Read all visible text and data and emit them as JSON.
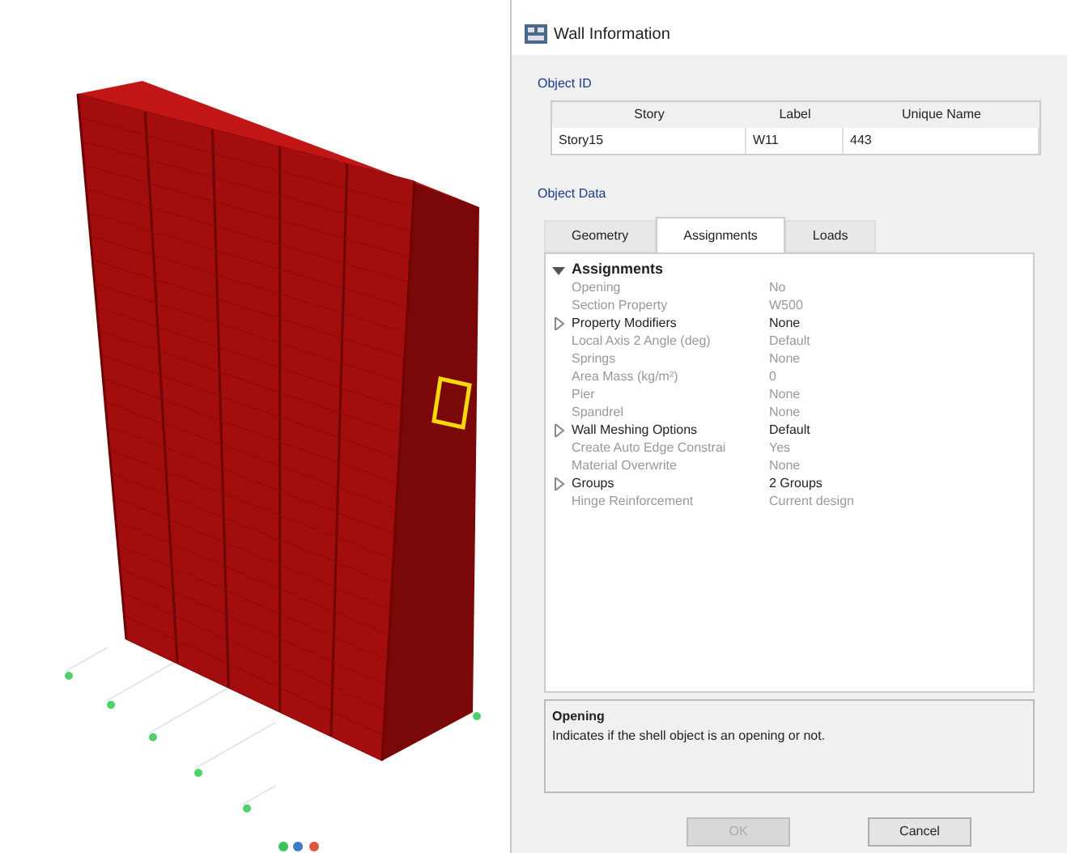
{
  "window": {
    "title": "Wall Information"
  },
  "object_id": {
    "title": "Object ID",
    "columns": [
      "Story",
      "Label",
      "Unique Name"
    ],
    "row": [
      "Story15",
      "W11",
      "443"
    ]
  },
  "object_data": {
    "title": "Object Data",
    "tabs": [
      {
        "label": "Geometry",
        "selected": false
      },
      {
        "label": "Assignments",
        "selected": true
      },
      {
        "label": "Loads",
        "selected": false
      }
    ],
    "rows": [
      {
        "kind": "header",
        "name": "Assignments",
        "expanded": true
      },
      {
        "kind": "item",
        "name": "Opening",
        "value": "No"
      },
      {
        "kind": "item",
        "name": "Section Property",
        "value": "W500"
      },
      {
        "kind": "expandable",
        "name": "Property Modifiers",
        "value": "None",
        "expanded": false
      },
      {
        "kind": "item",
        "name": "Local Axis 2 Angle (deg)",
        "value": "Default"
      },
      {
        "kind": "item",
        "name": "Springs",
        "value": "None"
      },
      {
        "kind": "item",
        "name": "Area Mass (kg/m²)",
        "value": "0"
      },
      {
        "kind": "item",
        "name": "Pier",
        "value": "None"
      },
      {
        "kind": "item",
        "name": "Spandrel",
        "value": "None"
      },
      {
        "kind": "expandable",
        "name": "Wall Meshing Options",
        "value": "Default",
        "expanded": false
      },
      {
        "kind": "item",
        "name": "Create Auto Edge Constrai",
        "value": "Yes"
      },
      {
        "kind": "item",
        "name": "Material Overwrite",
        "value": "None"
      },
      {
        "kind": "expandable",
        "name": "Groups",
        "value": "2 Groups",
        "expanded": false
      },
      {
        "kind": "item",
        "name": "Hinge Reinforcement",
        "value": "Current design"
      }
    ],
    "description": {
      "title": "Opening",
      "text": "Indicates if the shell object is an opening or not."
    }
  },
  "buttons": [
    {
      "label": "OK",
      "disabled": true
    },
    {
      "label": "Cancel",
      "disabled": false
    }
  ]
}
